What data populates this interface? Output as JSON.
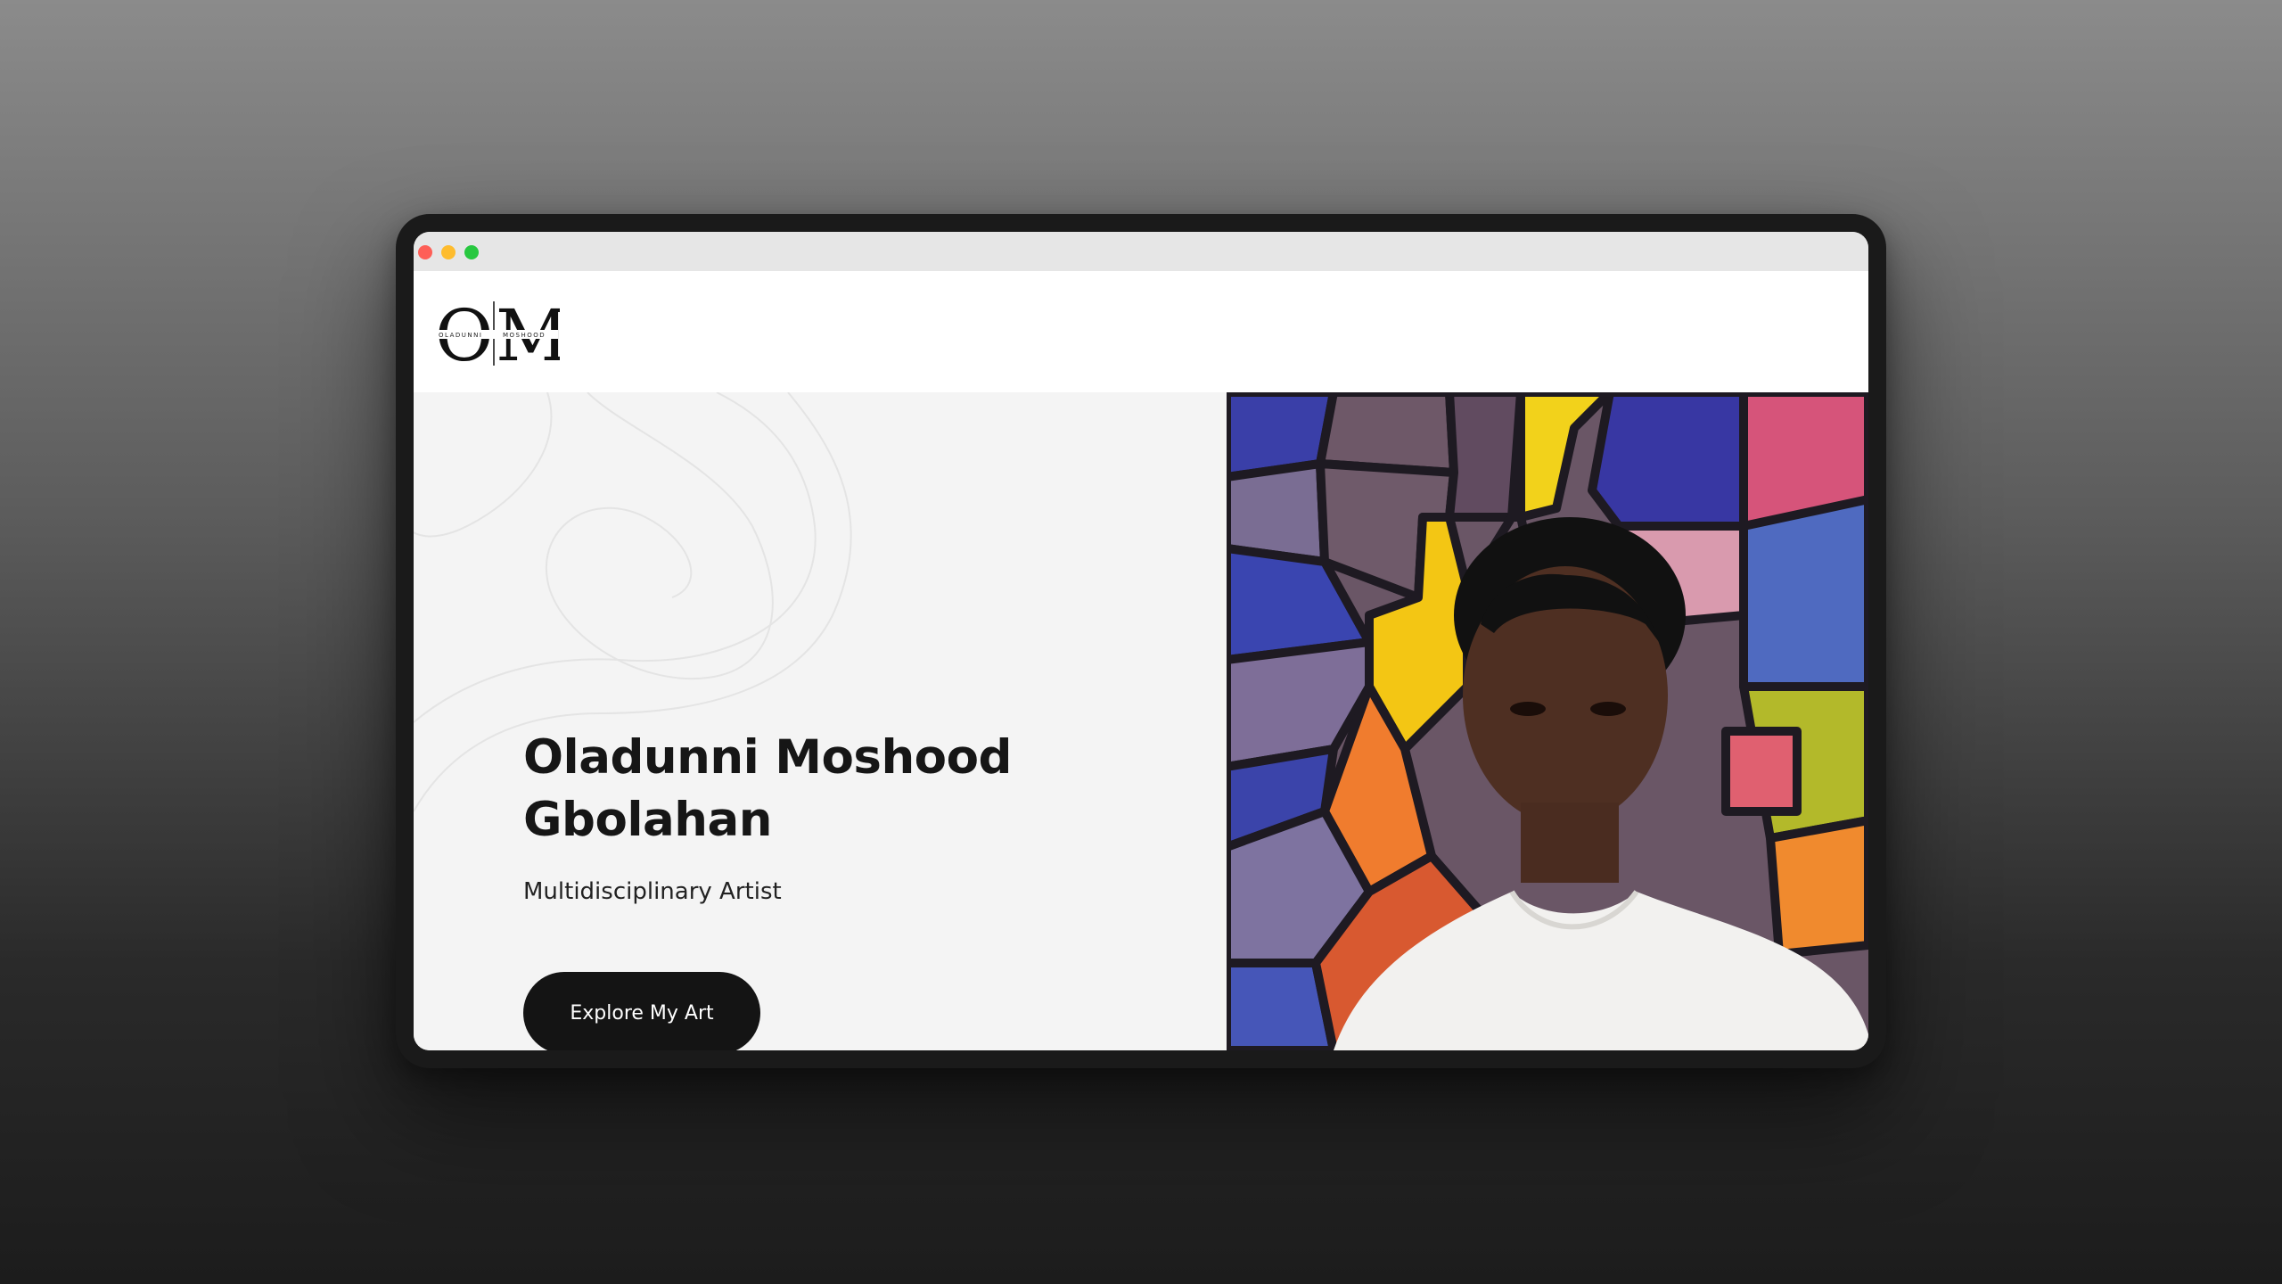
{
  "window": {
    "traffic_lights": [
      {
        "name": "close",
        "color": "#fe5f57"
      },
      {
        "name": "minimize",
        "color": "#febc2e"
      },
      {
        "name": "maximize",
        "color": "#28c840"
      }
    ]
  },
  "header": {
    "logo": {
      "monogram": "OM",
      "first_name": "OLADUNNI",
      "last_name": "MOSHOOD"
    }
  },
  "hero": {
    "title_line1": "Oladunni Moshood",
    "title_line2": "Gbolahan",
    "subtitle": "Multidisciplinary Artist",
    "cta_label": "Explore My Art"
  },
  "colors": {
    "hero_background": "#f4f4f4",
    "cta_background": "#141414",
    "cta_text": "#ffffff",
    "heading_text": "#161616"
  },
  "image": {
    "icon": "artist-portrait-photo"
  }
}
